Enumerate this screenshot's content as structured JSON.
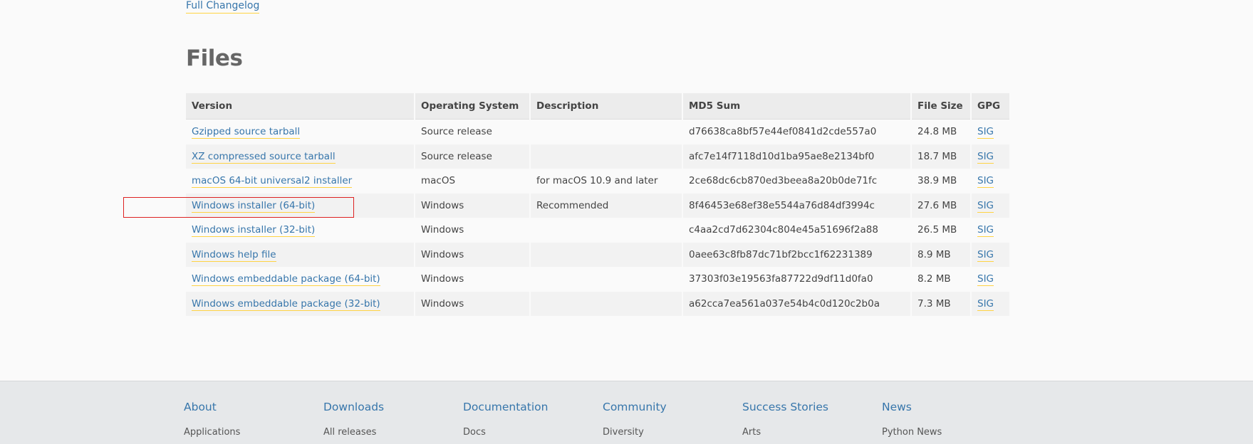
{
  "changelog_link": "Full Changelog",
  "files": {
    "title": "Files",
    "headers": [
      "Version",
      "Operating System",
      "Description",
      "MD5 Sum",
      "File Size",
      "GPG"
    ],
    "rows": [
      {
        "version": "Gzipped source tarball",
        "os": "Source release",
        "description": "",
        "md5": "d76638ca8bf57e44ef0841d2cde557a0",
        "size": "24.8 MB",
        "gpg": "SIG"
      },
      {
        "version": "XZ compressed source tarball",
        "os": "Source release",
        "description": "",
        "md5": "afc7e14f7118d10d1ba95ae8e2134bf0",
        "size": "18.7 MB",
        "gpg": "SIG"
      },
      {
        "version": "macOS 64-bit universal2 installer",
        "os": "macOS",
        "description": "for macOS 10.9 and later",
        "md5": "2ce68dc6cb870ed3beea8a20b0de71fc",
        "size": "38.9 MB",
        "gpg": "SIG"
      },
      {
        "version": "Windows installer (64-bit)",
        "os": "Windows",
        "description": "Recommended",
        "md5": "8f46453e68ef38e5544a76d84df3994c",
        "size": "27.6 MB",
        "gpg": "SIG"
      },
      {
        "version": "Windows installer (32-bit)",
        "os": "Windows",
        "description": "",
        "md5": "c4aa2cd7d62304c804e45a51696f2a88",
        "size": "26.5 MB",
        "gpg": "SIG"
      },
      {
        "version": "Windows help file",
        "os": "Windows",
        "description": "",
        "md5": "0aee63c8fb87dc71bf2bcc1f62231389",
        "size": "8.9 MB",
        "gpg": "SIG"
      },
      {
        "version": "Windows embeddable package (64-bit)",
        "os": "Windows",
        "description": "",
        "md5": "37303f03e19563fa87722d9df11d0fa0",
        "size": "8.2 MB",
        "gpg": "SIG"
      },
      {
        "version": "Windows embeddable package (32-bit)",
        "os": "Windows",
        "description": "",
        "md5": "a62cca7ea561a037e54b4c0d120c2b0a",
        "size": "7.3 MB",
        "gpg": "SIG"
      }
    ]
  },
  "highlight_color": "#dd2222",
  "footer": {
    "columns": [
      {
        "heading": "About",
        "first_item": "Applications"
      },
      {
        "heading": "Downloads",
        "first_item": "All releases"
      },
      {
        "heading": "Documentation",
        "first_item": "Docs"
      },
      {
        "heading": "Community",
        "first_item": "Diversity"
      },
      {
        "heading": "Success Stories",
        "first_item": "Arts"
      },
      {
        "heading": "News",
        "first_item": "Python News"
      }
    ]
  }
}
